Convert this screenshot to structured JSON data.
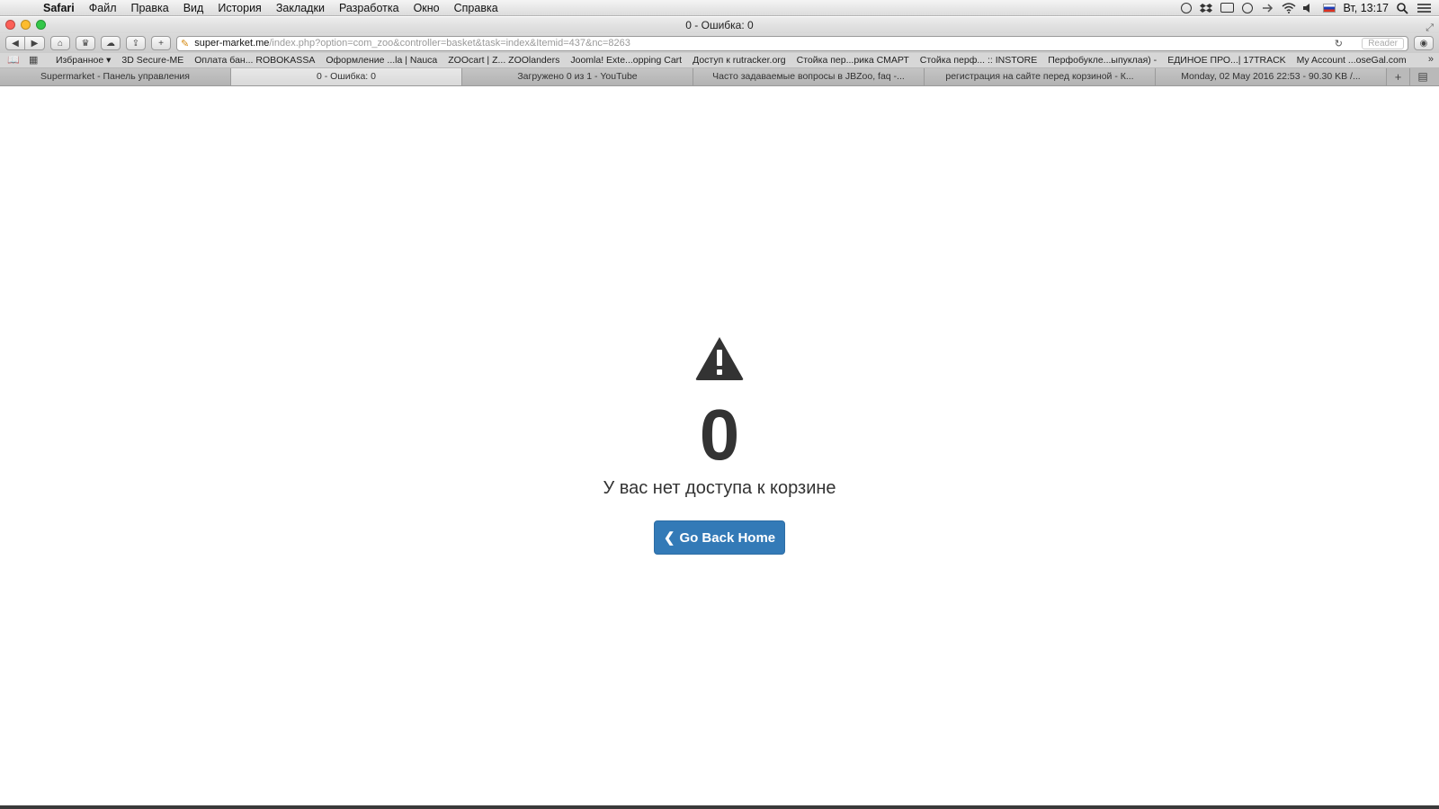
{
  "menubar": {
    "app": "Safari",
    "items": [
      "Файл",
      "Правка",
      "Вид",
      "История",
      "Закладки",
      "Разработка",
      "Окно",
      "Справка"
    ],
    "clock": "Вт, 13:17"
  },
  "window": {
    "title": "0 - Ошибка: 0"
  },
  "toolbar": {
    "url_host": "super-market.me",
    "url_path": "/index.php?option=com_zoo&controller=basket&task=index&Itemid=437&nc=8263",
    "reader_label": "Reader"
  },
  "bookmarks": [
    "Избранное ▾",
    "3D Secure-ME",
    "Оплата бан... ROBOKASSA",
    "Оформление ...la | Nauca",
    "ZOOcart | Z... ZOOlanders",
    "Joomla! Exte...opping Cart",
    "Доступ к rutracker.org",
    "Стойка пер...рика СМАРТ",
    "Стойка перф... :: INSTORE",
    "Перфобукле...ыпуклая) -",
    "ЕДИНОЕ ПРО...| 17TRACK",
    "My Account ...oseGal.com"
  ],
  "tabs": [
    "Supermarket - Панель управления",
    "0 - Ошибка: 0",
    "Загружено 0 из 1 - YouTube",
    "Часто задаваемые вопросы в JBZoo, faq -...",
    "регистрация на сайте перед корзиной - К...",
    "Monday, 02 May 2016 22:53 - 90.30 KB /..."
  ],
  "active_tab_index": 1,
  "error": {
    "code": "0",
    "message": "У вас нет доступа к корзине",
    "button_label": "Go Back Home",
    "button_color": "#337ab7"
  }
}
